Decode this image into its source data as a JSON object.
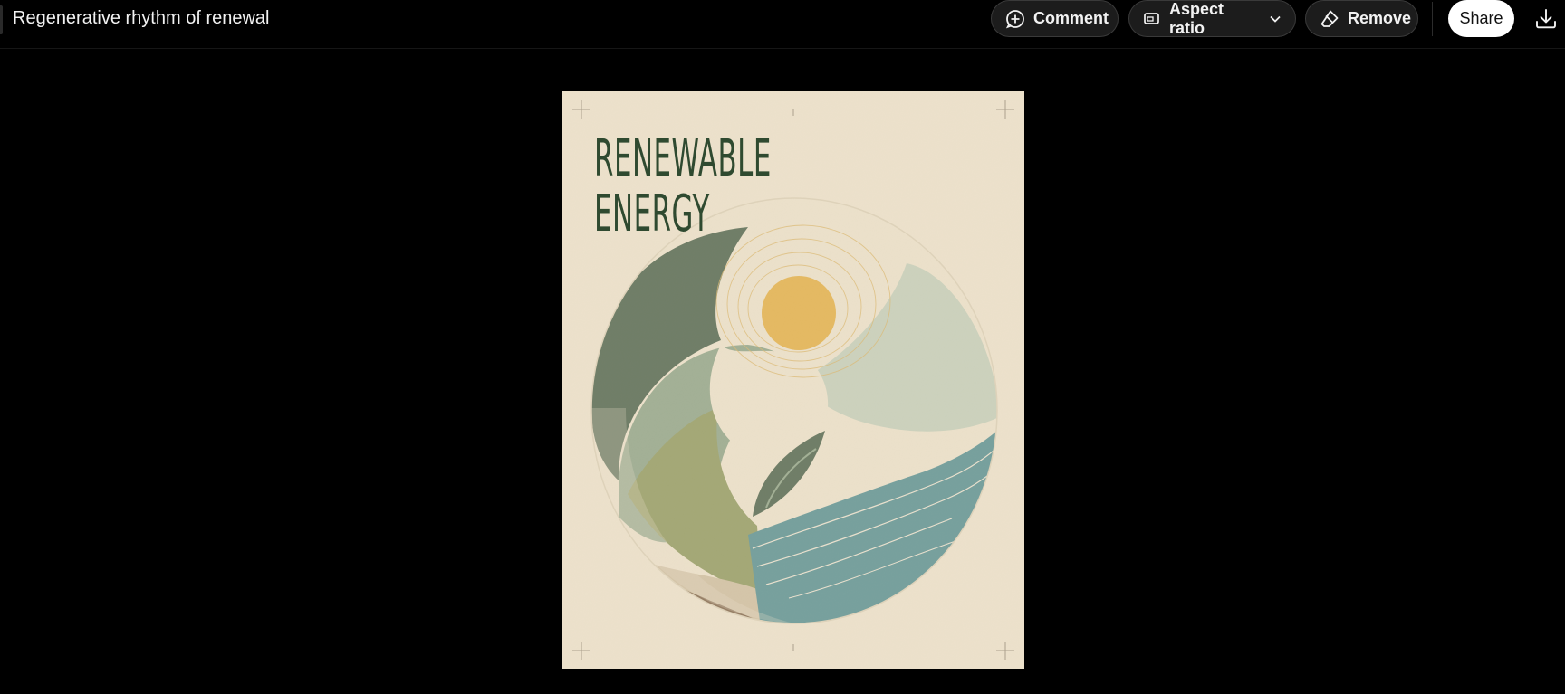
{
  "document": {
    "title": "Regenerative rhythm of renewal"
  },
  "toolbar": {
    "comment_label": "Comment",
    "aspect_ratio_label": "Aspect ratio",
    "remove_label": "Remove",
    "share_label": "Share"
  },
  "icons": {
    "comment": "plus-in-circle-icon",
    "aspect_ratio": "aspect-ratio-icon",
    "chevron": "chevron-down-icon",
    "remove": "eraser-icon",
    "download": "download-icon"
  },
  "poster": {
    "headline_line1": "RENEWABLE",
    "headline_line2": "ENERGY"
  },
  "colors": {
    "background": "#000000",
    "poster_paper": "#ede2cc",
    "headline": "#2f4a30",
    "sun": "#e1a52c",
    "forest_green": "#2f4a33",
    "sage": "#7d977a",
    "olive": "#7f8b4b",
    "teal": "#3a7f86",
    "earth": "#6a4c30"
  }
}
